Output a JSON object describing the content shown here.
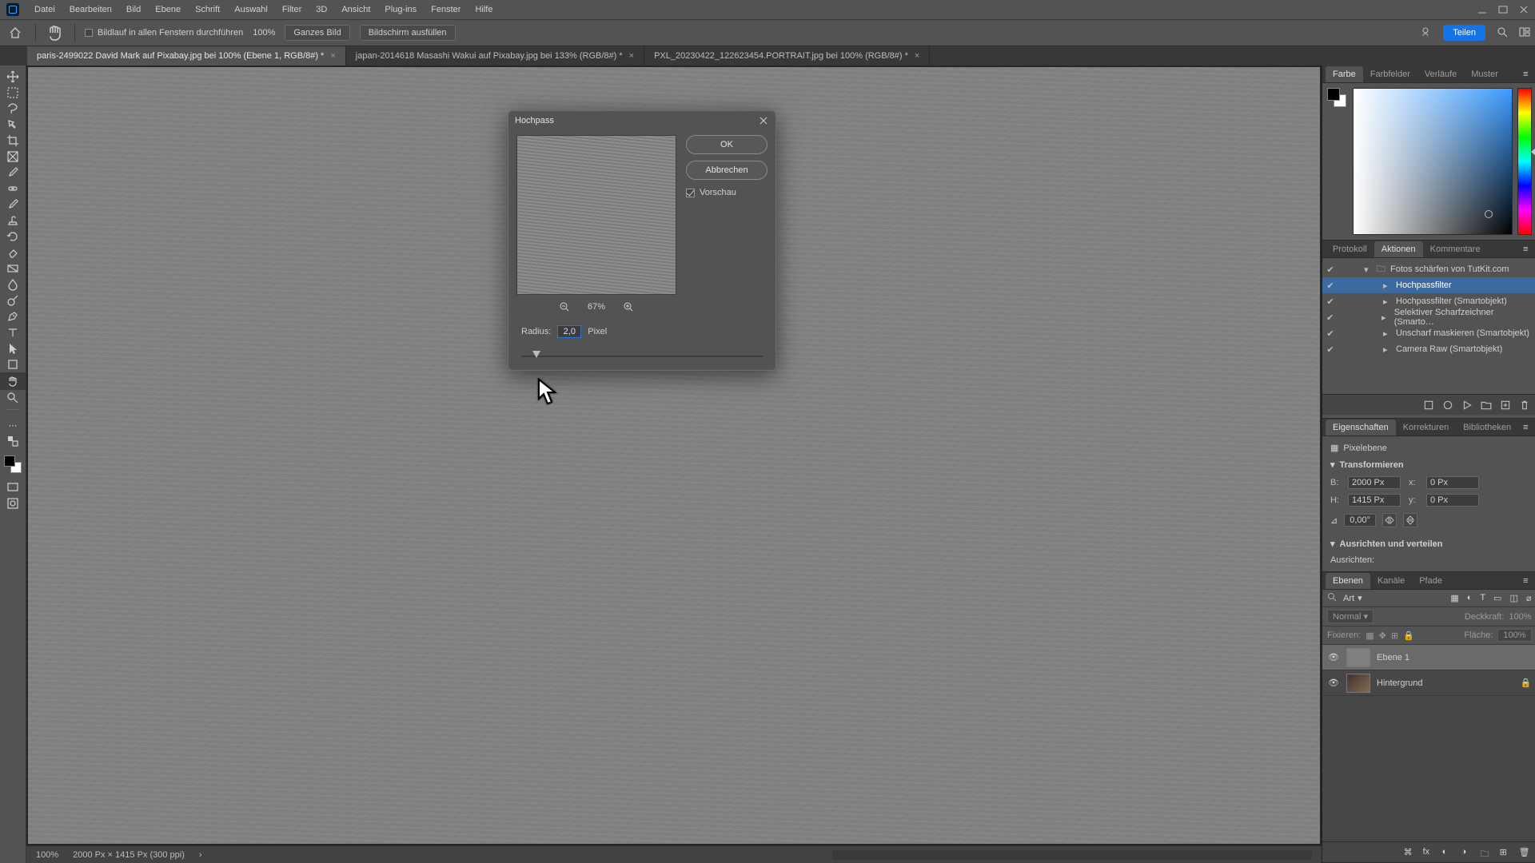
{
  "menu": {
    "items": [
      "Datei",
      "Bearbeiten",
      "Bild",
      "Ebene",
      "Schrift",
      "Auswahl",
      "Filter",
      "3D",
      "Ansicht",
      "Plug-ins",
      "Fenster",
      "Hilfe"
    ]
  },
  "optionbar": {
    "scroll_all_label": "Bildlauf in allen Fenstern durchführen",
    "zoom_value": "100%",
    "fit_whole_image": "Ganzes Bild",
    "fill_screen": "Bildschirm ausfüllen",
    "share_label": "Teilen"
  },
  "doctabs": [
    {
      "label": "paris-2499022  David Mark auf Pixabay.jpg bei 100% (Ebene 1, RGB/8#) *",
      "active": true
    },
    {
      "label": "japan-2014618 Masashi Wakui auf Pixabay.jpg bei 133% (RGB/8#) *",
      "active": false
    },
    {
      "label": "PXL_20230422_122623454.PORTRAIT.jpg bei 100% (RGB/8#) *",
      "active": false
    }
  ],
  "dialog": {
    "title": "Hochpass",
    "ok": "OK",
    "cancel": "Abbrechen",
    "preview_label": "Vorschau",
    "preview_checked": true,
    "zoom_pct": "67%",
    "radius_label": "Radius:",
    "radius_value": "2,0",
    "radius_unit": "Pixel"
  },
  "status": {
    "zoom": "100%",
    "doc_info": "2000 Px × 1415 Px (300 ppi)"
  },
  "farbe_tabs": [
    "Farbe",
    "Farbfelder",
    "Verläufe",
    "Muster"
  ],
  "aktionen": {
    "tabs": [
      "Protokoll",
      "Aktionen",
      "Kommentare"
    ],
    "set_name": "Fotos schärfen von TutKit.com",
    "rows": [
      "Hochpassfilter",
      "Hochpassfilter (Smartobjekt)",
      "Selektiver Scharfzeichner (Smarto…",
      "Unscharf maskieren (Smartobjekt)",
      "Camera Raw (Smartobjekt)"
    ]
  },
  "eigen": {
    "tabs": [
      "Eigenschaften",
      "Korrekturen",
      "Bibliotheken"
    ],
    "kind": "Pixelebene",
    "transform_header": "Transformieren",
    "w_label": "B:",
    "w_value": "2000 Px",
    "x_label": "x:",
    "x_value": "0 Px",
    "h_label": "H:",
    "h_value": "1415 Px",
    "y_label": "y:",
    "y_value": "0 Px",
    "angle_value": "0,00°",
    "align_header": "Ausrichten und verteilen",
    "align_label": "Ausrichten:"
  },
  "ebenen": {
    "tabs": [
      "Ebenen",
      "Kanäle",
      "Pfade"
    ],
    "filter_kind": "Art",
    "blend_mode": "Normal",
    "opacity_label": "Deckkraft:",
    "opacity_value": "100%",
    "lock_label": "Fixieren:",
    "fill_label": "Fläche:",
    "fill_value": "100%",
    "layers": [
      {
        "name": "Ebene 1",
        "selected": true,
        "bg": false
      },
      {
        "name": "Hintergrund",
        "selected": false,
        "bg": true,
        "locked": true
      }
    ]
  }
}
